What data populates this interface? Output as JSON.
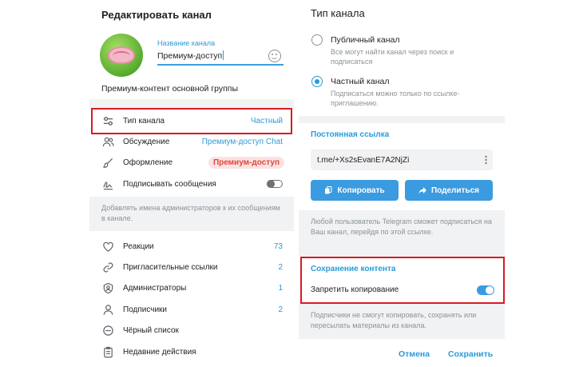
{
  "left": {
    "title": "Редактировать канал",
    "name_label": "Название канала",
    "name_value": "Премиум-доступ",
    "description": "Премиум-контент основной группы",
    "rows": [
      {
        "label": "Тип канала",
        "value": "Частный",
        "icon": "sliders-icon"
      },
      {
        "label": "Обсуждение",
        "value": "Премиум-доступ Chat",
        "icon": "users-icon"
      },
      {
        "label": "Оформление",
        "value": "Премиум-доступ",
        "icon": "brush-icon"
      },
      {
        "label": "Подписывать сообщения",
        "value": "",
        "icon": "signature-icon",
        "toggle": "off"
      }
    ],
    "sign_hint": "Добавлять имена администраторов к их сообщениям в канале.",
    "rows2": [
      {
        "label": "Реакции",
        "value": "73",
        "icon": "heart-icon"
      },
      {
        "label": "Пригласительные ссылки",
        "value": "2",
        "icon": "link-icon"
      },
      {
        "label": "Администраторы",
        "value": "1",
        "icon": "shield-icon"
      },
      {
        "label": "Подписчики",
        "value": "2",
        "icon": "user-icon"
      },
      {
        "label": "Чёрный список",
        "value": "",
        "icon": "block-icon"
      },
      {
        "label": "Недавние действия",
        "value": "",
        "icon": "clipboard-icon"
      }
    ]
  },
  "right": {
    "title": "Тип канала",
    "options": [
      {
        "title": "Публичный канал",
        "desc": "Все могут найти канал через поиск и подписаться",
        "selected": false
      },
      {
        "title": "Частный канал",
        "desc": "Подписаться можно только по ссылке-приглашению.",
        "selected": true
      }
    ],
    "link_header": "Постоянная ссылка",
    "link_value": "t.me/+Xs2sEvanE7A2NjZi",
    "copy_label": "Копировать",
    "share_label": "Поделиться",
    "link_hint": "Любой пользователь Telegram сможет подписаться на Ваш канал, перейдя по этой ссылке.",
    "content_header": "Сохранение контента",
    "restrict_label": "Запретить копирование",
    "restrict_on": true,
    "restrict_hint": "Подписчики не смогут копировать, сохранять или пересылать материалы из канала.",
    "cancel_label": "Отмена",
    "save_label": "Сохранить"
  },
  "colors": {
    "accent": "#2a9bd8",
    "button": "#3b9be0",
    "highlight": "#d81b23",
    "badge_text": "#e0463e",
    "badge_bg": "#fbe3e2"
  }
}
